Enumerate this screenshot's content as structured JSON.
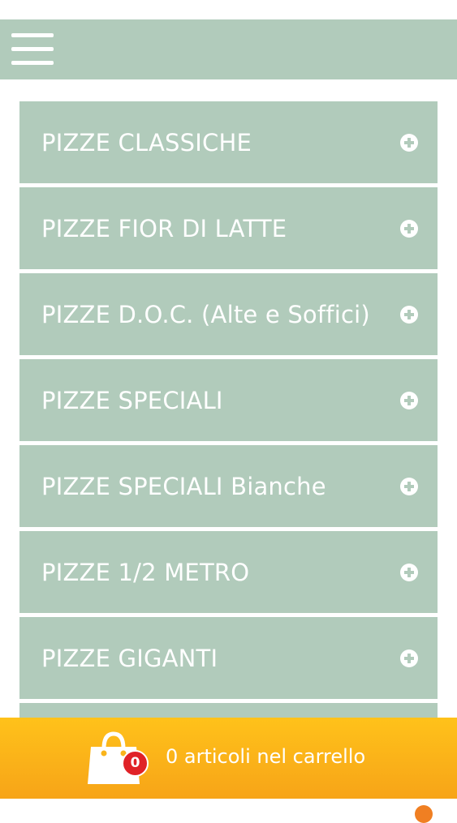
{
  "header": {
    "menu_icon": "hamburger-icon"
  },
  "categories": [
    {
      "label": "PIZZE CLASSICHE",
      "icon": "plus-circle-icon"
    },
    {
      "label": "PIZZE FIOR DI LATTE",
      "icon": "plus-circle-icon"
    },
    {
      "label": "PIZZE D.O.C. (Alte e Soffici)",
      "icon": "plus-circle-icon"
    },
    {
      "label": "PIZZE SPECIALI",
      "icon": "plus-circle-icon"
    },
    {
      "label": "PIZZE SPECIALI Bianche",
      "icon": "plus-circle-icon"
    },
    {
      "label": "PIZZE 1/2 METRO",
      "icon": "plus-circle-icon"
    },
    {
      "label": "PIZZE GIGANTI",
      "icon": "plus-circle-icon"
    },
    {
      "label": "",
      "icon": ""
    }
  ],
  "cart": {
    "count": "0",
    "text": "0 articoli nel carrello",
    "icon": "shopping-bag-icon"
  },
  "colors": {
    "header_bg": "#b1cbbb",
    "item_bg": "#b1cbbb",
    "cart_bg": "#f7a418",
    "badge_bg": "#e02227"
  }
}
